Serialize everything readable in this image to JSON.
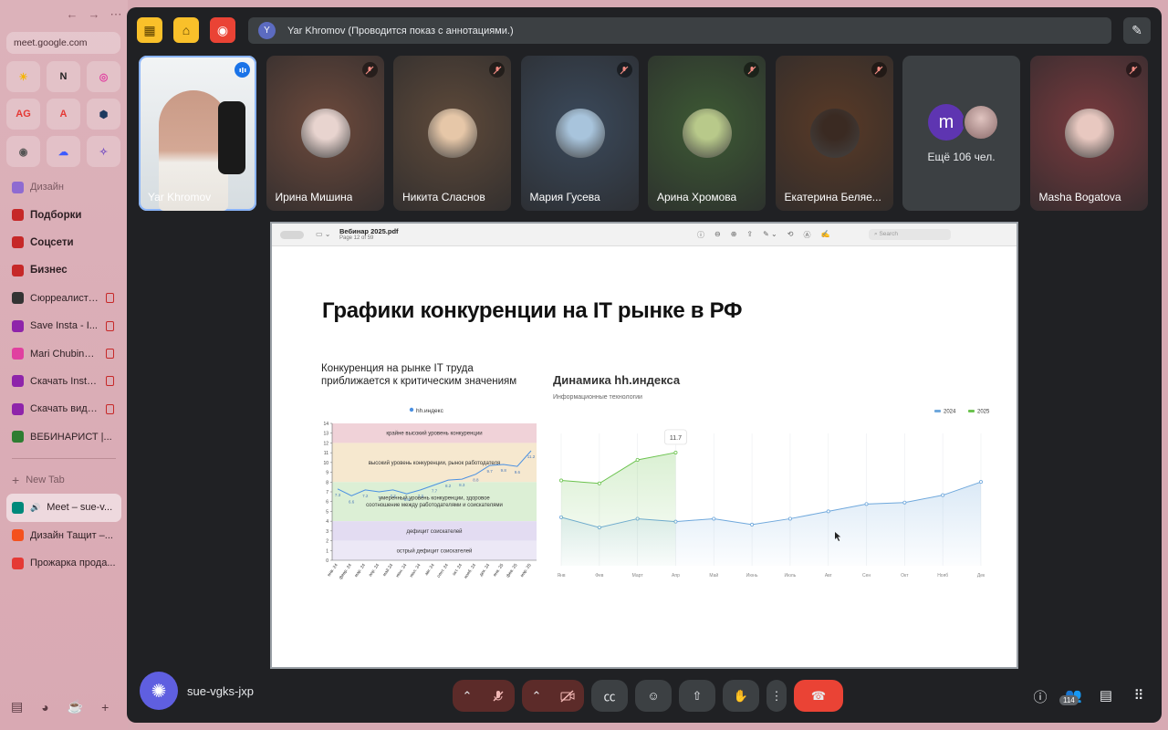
{
  "browser": {
    "nav": {
      "back": "←",
      "forward": "→",
      "menu": "⋯"
    },
    "url": "meet.google.com",
    "pins": [
      "☀",
      "N",
      "◎",
      "AG",
      "A",
      "⬢",
      "◉",
      "☁",
      "✧"
    ],
    "items": [
      {
        "label": "Дизайн",
        "style": "muted",
        "icon_color": "#8e6bd1"
      },
      {
        "label": "Подборки",
        "style": "bold",
        "icon_color": "#c62828"
      },
      {
        "label": "Соцсети",
        "style": "bold",
        "icon_color": "#c62828"
      },
      {
        "label": "Бизнес",
        "style": "bold",
        "icon_color": "#c62828"
      },
      {
        "label": "Сюрреалисти...",
        "style": "rec",
        "icon_color": "#333333"
      },
      {
        "label": "Save Insta - I...",
        "style": "rec",
        "icon_color": "#8e24aa"
      },
      {
        "label": "Mari Chubina |...",
        "style": "rec",
        "icon_color": "#e040a0"
      },
      {
        "label": "Скачать Insta...",
        "style": "rec",
        "icon_color": "#8e24aa"
      },
      {
        "label": "Скачать виде...",
        "style": "rec",
        "icon_color": "#8e24aa"
      },
      {
        "label": "ВЕБИНАРИСТ |...",
        "style": "plain",
        "icon_color": "#2e7d32"
      }
    ],
    "new_tab": "New Tab",
    "tabs": [
      {
        "label": "Meet – sue-v...",
        "active": true,
        "icon_color": "#00897b"
      },
      {
        "label": "Дизайн Тащит –...",
        "active": false,
        "icon_color": "#f4511e"
      },
      {
        "label": "Прожарка прода...",
        "active": false,
        "icon_color": "#e53935"
      }
    ],
    "bottom": {
      "add": "+"
    }
  },
  "meet": {
    "banner_initial": "Y",
    "banner_text": "Yar Khromov (Проводится показ с аннотациями.)",
    "participants": [
      {
        "name": "Yar Khromov",
        "bg": "#dfe6ea",
        "muted": false,
        "active": true,
        "face": "#c99a86"
      },
      {
        "name": "Ирина Мишина",
        "bg": "#6e4a3c",
        "muted": true,
        "face": "#e8d4cf"
      },
      {
        "name": "Никита Сласнов",
        "bg": "#5f4a3a",
        "muted": true,
        "face": "#e6c7a8"
      },
      {
        "name": "Мария Гусева",
        "bg": "#3b4a5c",
        "muted": true,
        "face": "#a8c4dc"
      },
      {
        "name": "Арина Хромова",
        "bg": "#3d5a34",
        "muted": true,
        "face": "#b8c98a"
      },
      {
        "name": "Екатерина Беляе...",
        "bg": "#5a3a26",
        "muted": true,
        "face": "#3a2a22"
      },
      {
        "name": "Masha Bogatova",
        "bg": "#7a3a3e",
        "muted": true,
        "face": "#e8c8c0"
      }
    ],
    "more": {
      "initial": "m",
      "label": "Ещё 106 чел."
    },
    "meeting_code": "sue-vgks-jxp",
    "people_count": "114"
  },
  "pdf": {
    "filename": "Вебинар 2025.pdf",
    "page": "Page 12 of 59",
    "search_placeholder": "Search",
    "slide_title": "Графики конкуренции на IT рынке в РФ"
  },
  "chart_data": [
    {
      "type": "line",
      "title": "Конкуренция на рынке IT труда приближается к критическим значениям",
      "legend": [
        "hh.индекс"
      ],
      "ylim": [
        0,
        14
      ],
      "x": [
        "янв. 24",
        "февр. 24",
        "мар. 24",
        "апр. 24",
        "май 24",
        "июн. 24",
        "июл. 24",
        "авг. 24",
        "сент. 24",
        "окт. 24",
        "нояб. 24",
        "дек. 24",
        "янв. 25",
        "фев. 25",
        "мар. 25"
      ],
      "values": [
        7.3,
        6.6,
        7.2,
        7.0,
        7.2,
        6.8,
        7.2,
        7.7,
        8.2,
        8.3,
        8.8,
        9.7,
        9.8,
        9.6,
        11.2
      ],
      "labels": [
        "7.3",
        "6.6",
        "7.2",
        "7",
        "7.2",
        "6.8",
        "7.2",
        "7.7",
        "8.2",
        "8.3",
        "8.8",
        "9.7",
        "9.8",
        "9.6",
        "11.2"
      ],
      "bands": [
        {
          "label": "крайне высокий уровень конкуренции",
          "from": 12,
          "to": 14,
          "color": "#f0d2d8"
        },
        {
          "label": "высокий уровень конкуренции, рынок работодателя",
          "from": 8,
          "to": 12,
          "color": "#f6e8cf"
        },
        {
          "label": "умеренный уровень конкуренции, здоровое соотношение между работодателями и соискателями",
          "from": 4,
          "to": 8,
          "color": "#dcefd5"
        },
        {
          "label": "дефицит соискателей",
          "from": 2,
          "to": 4,
          "color": "#e3dcf2"
        },
        {
          "label": "острый дефицит соискателей",
          "from": 0,
          "to": 2,
          "color": "#ece8f6"
        }
      ]
    },
    {
      "type": "line",
      "title": "Динамика hh.индекса",
      "subtitle": "Информационные технологии",
      "categories": [
        "Янв",
        "Фев",
        "Март",
        "Апр",
        "Май",
        "Июнь",
        "Июль",
        "Авг",
        "Сен",
        "Окт",
        "Нояб",
        "Дек"
      ],
      "series": [
        {
          "name": "2024",
          "color": "#6fa8dc",
          "values": [
            7.3,
            6.6,
            7.2,
            7.0,
            7.2,
            6.8,
            7.2,
            7.7,
            8.2,
            8.3,
            8.8,
            9.7
          ]
        },
        {
          "name": "2025",
          "color": "#6cc34f",
          "values": [
            9.8,
            9.6,
            11.2,
            11.7
          ]
        }
      ],
      "tooltip": "11.7",
      "ylim": [
        4,
        13
      ]
    }
  ]
}
